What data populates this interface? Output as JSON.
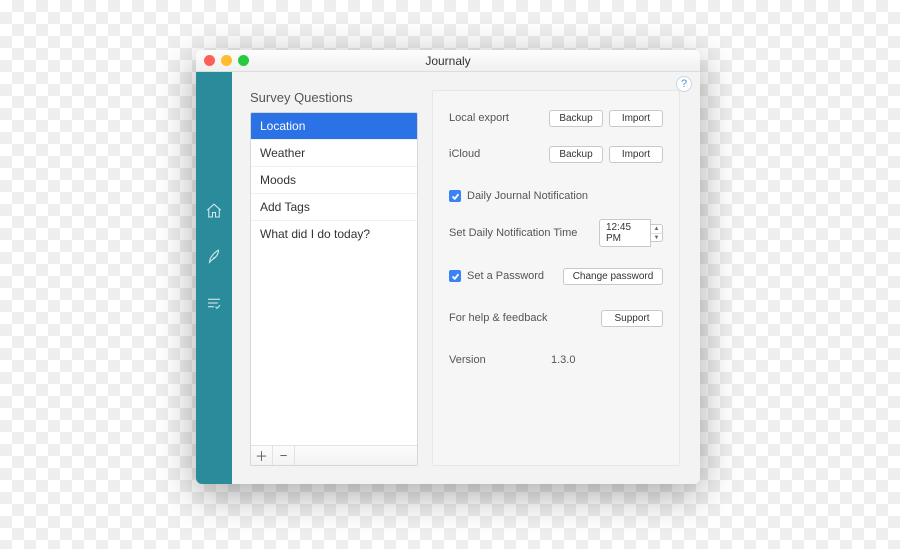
{
  "app_title": "Journaly",
  "help_glyph": "?",
  "sidebar": {
    "items": [
      {
        "name": "home-icon"
      },
      {
        "name": "compose-icon"
      },
      {
        "name": "list-icon"
      }
    ]
  },
  "survey": {
    "title": "Survey Questions",
    "items": [
      {
        "label": "Location",
        "selected": true
      },
      {
        "label": "Weather",
        "selected": false
      },
      {
        "label": "Moods",
        "selected": false
      },
      {
        "label": "Add Tags",
        "selected": false
      },
      {
        "label": "What did I do today?",
        "selected": false
      }
    ],
    "add_glyph": "＋",
    "remove_glyph": "−"
  },
  "settings": {
    "local_export": {
      "label": "Local export",
      "backup": "Backup",
      "import": "Import"
    },
    "icloud": {
      "label": "iCloud",
      "backup": "Backup",
      "import": "Import"
    },
    "daily_notification": {
      "checked": true,
      "label": "Daily Journal Notification"
    },
    "daily_time": {
      "label": "Set Daily Notification Time",
      "value": "12:45 PM"
    },
    "password": {
      "checked": true,
      "label": "Set a Password",
      "button": "Change password"
    },
    "help": {
      "label": "For help & feedback",
      "button": "Support"
    },
    "version": {
      "label": "Version",
      "value": "1.3.0"
    }
  }
}
